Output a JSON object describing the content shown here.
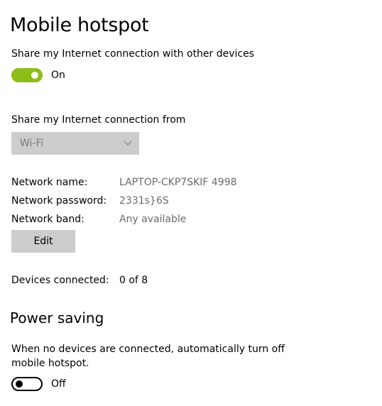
{
  "header": {
    "title": "Mobile hotspot"
  },
  "share": {
    "label": "Share my Internet connection with other devices",
    "toggle_state": "On",
    "toggle_on": true,
    "accent_color": "#8cbd18"
  },
  "source": {
    "label": "Share my Internet connection from",
    "selected": "Wi-Fi"
  },
  "network": {
    "name_label": "Network name:",
    "name_value": "LAPTOP-CKP7SKIF 4998",
    "password_label": "Network password:",
    "password_value": "2331s}6S",
    "band_label": "Network band:",
    "band_value": "Any available",
    "edit_label": "Edit"
  },
  "devices": {
    "label": "Devices connected:",
    "value": "0 of 8"
  },
  "power_saving": {
    "title": "Power saving",
    "description": "When no devices are connected, automatically turn off mobile hotspot.",
    "toggle_state": "Off",
    "toggle_on": false
  }
}
